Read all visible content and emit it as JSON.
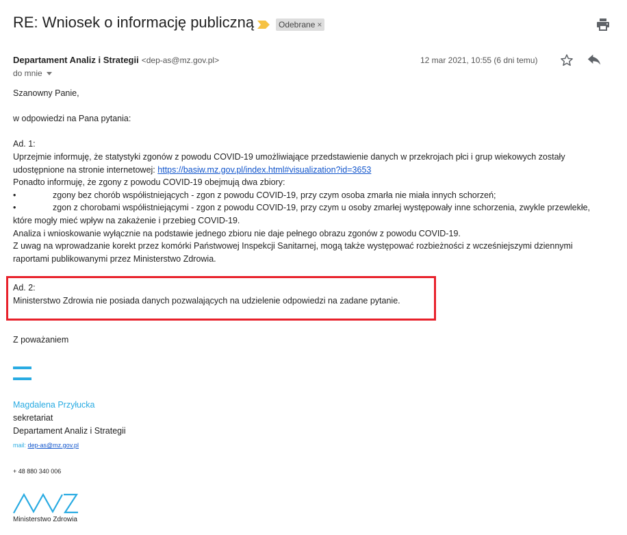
{
  "header": {
    "subject": "RE: Wniosek o informację publiczną",
    "label": "Odebrane",
    "label_close": "×"
  },
  "message": {
    "sender_name": "Departament Analiz i Strategii",
    "sender_email": "<dep-as@mz.gov.pl>",
    "recipient": "do mnie",
    "date": "12 mar 2021, 10:55 (6 dni temu)"
  },
  "body": {
    "greeting": "Szanowny Panie,",
    "intro": "w odpowiedzi na Pana pytania:",
    "ad1_title": "Ad. 1:",
    "ad1_line1": "Uprzejmie informuję, że statystyki zgonów z powodu COVID-19 umożliwiające przedstawienie danych w przekrojach płci i grup wiekowych zostały",
    "ad1_line2": "udostępnione na stronie internetowej: ",
    "ad1_link": "https://basiw.mz.gov.pl/index.html#visualization?id=3653",
    "ad1_line3": "Ponadto informuję, że zgony z powodu COVID-19 obejmują dwa zbiory:",
    "bullet_char": "•",
    "bullet1": "zgony bez chorób współistniejących - zgon z powodu COVID-19, przy czym osoba zmarła nie miała innych schorzeń;",
    "bullet2": "zgon z chorobami współistniejącymi - zgon z powodu COVID-19, przy czym u osoby zmarłej występowały inne schorzenia, zwykle przewlekłe,",
    "bullet2_cont": "które mogły mieć wpływ na zakażenie i przebieg COVID-19.",
    "line_analysis": "Analiza i wnioskowanie wyłącznie na podstawie jednego zbioru nie daje pełnego obrazu zgonów z powodu COVID-19.",
    "line_uwaga1": "Z uwag na wprowadzanie korekt przez komórki Państwowej Inspekcji Sanitarnej, mogą także występować rozbieżności z wcześniejszymi dziennymi",
    "line_uwaga2": "raportami publikowanymi przez Ministerstwo Zdrowia.",
    "ad2_title": "Ad. 2:",
    "ad2_text": "Ministerstwo Zdrowia nie posiada danych pozwalających na udzielenie odpowiedzi na zadane pytanie.",
    "regards": "Z poważaniem"
  },
  "signature": {
    "name": "Magdalena Przyłucka",
    "role": "sekretariat",
    "department": "Departament Analiz i Strategii",
    "mail_label": "mail: ",
    "mail_link": "dep-as@mz.gov.pl",
    "phone": "+ 48 880 340 006",
    "logo_text": "Ministerstwo Zdrowia"
  },
  "colors": {
    "accent_blue": "#29abe2",
    "highlight_red": "#e8202a",
    "link": "#1155cc",
    "importance": "#f6c242"
  },
  "icons": [
    "importance-marker-icon",
    "print-icon",
    "star-icon",
    "reply-icon",
    "chevron-down-icon",
    "mz-logo-icon"
  ]
}
